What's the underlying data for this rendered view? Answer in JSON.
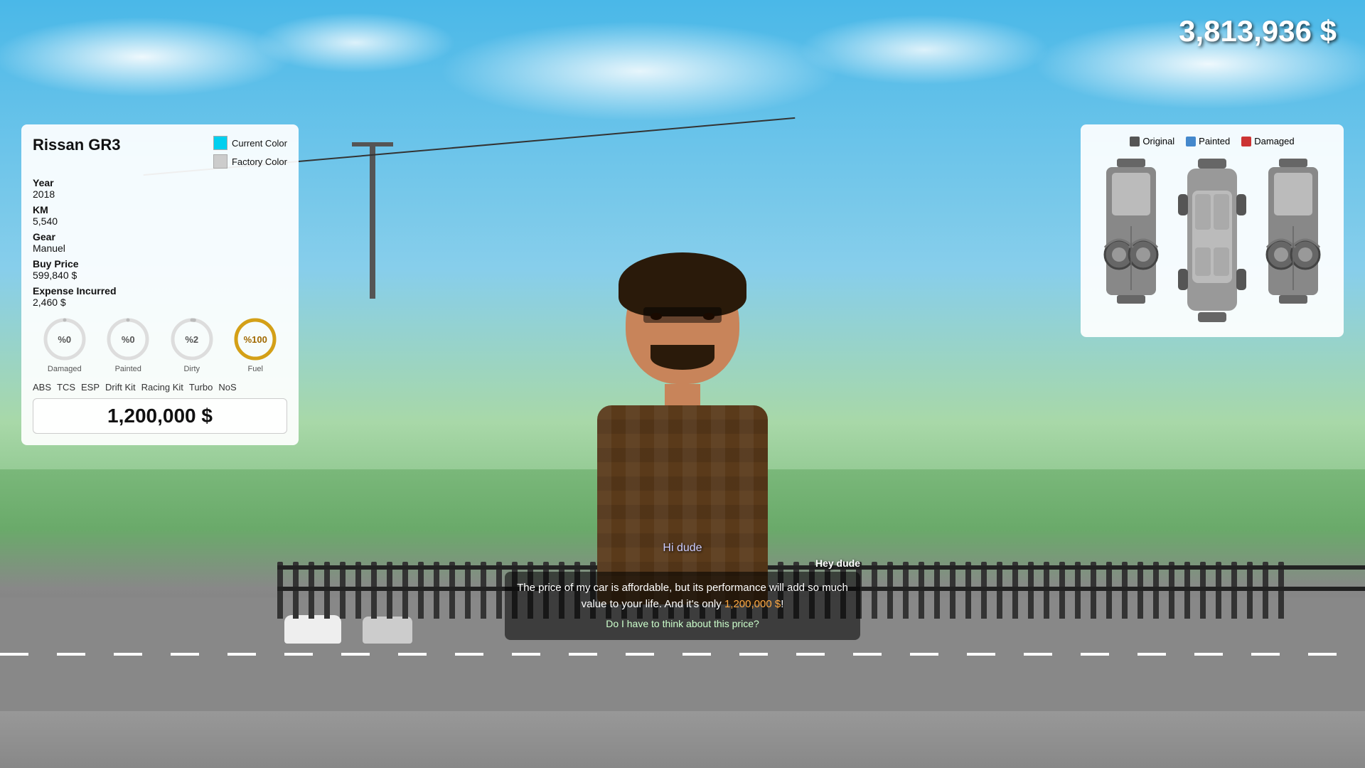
{
  "hud": {
    "money": "3,813,936 $"
  },
  "car_panel": {
    "title": "Rissan GR3",
    "color_current_label": "Current Color",
    "color_current_hex": "#00cfef",
    "color_factory_label": "Factory Color",
    "color_factory_hex": "#cccccc",
    "year_label": "Year",
    "year_value": "2018",
    "km_label": "KM",
    "km_value": "5,540",
    "gear_label": "Gear",
    "gear_value": "Manuel",
    "buy_price_label": "Buy Price",
    "buy_price_value": "599,840 $",
    "expense_label": "Expense Incurred",
    "expense_value": "2,460 $",
    "gauges": [
      {
        "id": "damaged",
        "label": "Damaged",
        "value": 0,
        "display": "%0",
        "color": "#bbb",
        "bg": "#ddd",
        "pct": 0
      },
      {
        "id": "painted",
        "label": "Painted",
        "value": 0,
        "display": "%0",
        "color": "#bbb",
        "bg": "#ddd",
        "pct": 0
      },
      {
        "id": "dirty",
        "label": "Dirty",
        "value": 2,
        "display": "%2",
        "color": "#bbb",
        "bg": "#ddd",
        "pct": 2
      },
      {
        "id": "fuel",
        "label": "Fuel",
        "value": 100,
        "display": "%100",
        "color": "#d4a017",
        "bg": "#ddd",
        "pct": 100
      }
    ],
    "extras": [
      "ABS",
      "TCS",
      "ESP",
      "Drift Kit",
      "Racing Kit",
      "Turbo",
      "NoS"
    ],
    "final_price": "1,200,000 $"
  },
  "diagram_panel": {
    "legend": [
      {
        "label": "Original",
        "color": "#555"
      },
      {
        "label": "Painted",
        "color": "#4488cc"
      },
      {
        "label": "Damaged",
        "color": "#cc3333"
      }
    ]
  },
  "dialogue": {
    "npc_text": "Hi dude",
    "speaker": "Hey dude",
    "main_text": "The price of my car is affordable, but its performance will add so much value to your life. And it's only",
    "highlight": "1,200,000 $",
    "question": "Do I have to think about this price?"
  }
}
